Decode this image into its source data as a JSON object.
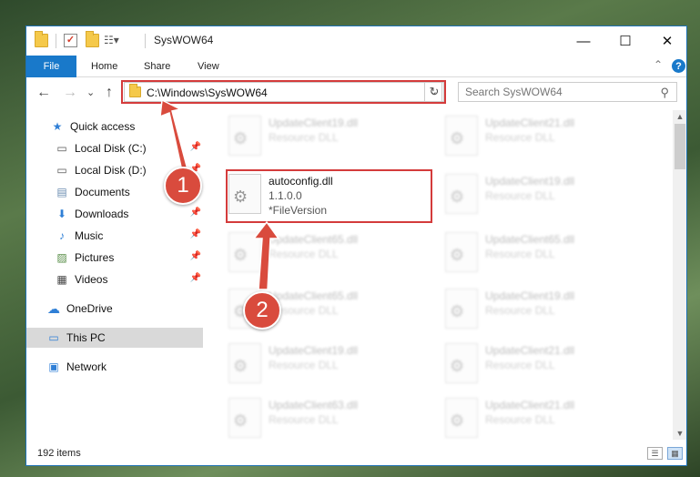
{
  "window": {
    "title": "SysWOW64",
    "minimize_glyph": "—",
    "maximize_glyph": "☐",
    "close_glyph": "✕"
  },
  "ribbon": {
    "tabs": [
      "File",
      "Home",
      "Share",
      "View"
    ],
    "collapse_glyph": "⌃",
    "help_glyph": "?"
  },
  "nav": {
    "back_glyph": "←",
    "forward_glyph": "→",
    "recent_glyph": "⌄",
    "up_glyph": "↑",
    "address": "C:\\Windows\\SysWOW64",
    "address_dropdown_glyph": "⌄",
    "refresh_glyph": "↻",
    "search_placeholder": "Search SysWOW64",
    "search_glyph": "⚲"
  },
  "sidebar": {
    "items": [
      {
        "label": "Quick access",
        "icon": "★"
      },
      {
        "label": "Local Disk (C:)",
        "icon": "▭"
      },
      {
        "label": "Local Disk (D:)",
        "icon": "▭"
      },
      {
        "label": "Documents",
        "icon": "▤"
      },
      {
        "label": "Downloads",
        "icon": "⬇"
      },
      {
        "label": "Music",
        "icon": "♪"
      },
      {
        "label": "Pictures",
        "icon": "▨"
      },
      {
        "label": "Videos",
        "icon": "▦"
      },
      {
        "label": "OneDrive",
        "icon": "☁"
      },
      {
        "label": "This PC",
        "icon": "▭"
      },
      {
        "label": "Network",
        "icon": "▣"
      }
    ],
    "pin_glyph": "📌"
  },
  "files": {
    "left": [
      {
        "name": "UpdateClient19.dll",
        "desc": "Resource DLL"
      },
      {
        "name": "autoconfig.dll",
        "desc": "1.1.0.0",
        "desc2": "*FileVersion"
      },
      {
        "name": "UpdateClient65.dll",
        "desc": "Resource DLL"
      },
      {
        "name": "UpdateClient65.dll",
        "desc": "Resource DLL"
      },
      {
        "name": "UpdateClient19.dll",
        "desc": "Resource DLL"
      },
      {
        "name": "UpdateClient63.dll",
        "desc": "Resource DLL"
      }
    ],
    "right": [
      {
        "name": "UpdateClient21.dll",
        "desc": "Resource DLL"
      },
      {
        "name": "UpdateClient19.dll",
        "desc": "Resource DLL"
      },
      {
        "name": "UpdateClient65.dll",
        "desc": "Resource DLL"
      },
      {
        "name": "UpdateClient19.dll",
        "desc": "Resource DLL"
      },
      {
        "name": "UpdateClient21.dll",
        "desc": "Resource DLL"
      },
      {
        "name": "UpdateClient21.dll",
        "desc": "Resource DLL"
      }
    ]
  },
  "scroll": {
    "up_glyph": "▲",
    "down_glyph": "▼"
  },
  "status": {
    "item_count": "192 items",
    "details_view_glyph": "☰",
    "tiles_view_glyph": "▦"
  },
  "callouts": {
    "one": "1",
    "two": "2"
  },
  "colors": {
    "highlight": "#d43b3b",
    "accent": "#1979ca",
    "badge": "#d94b3d"
  }
}
